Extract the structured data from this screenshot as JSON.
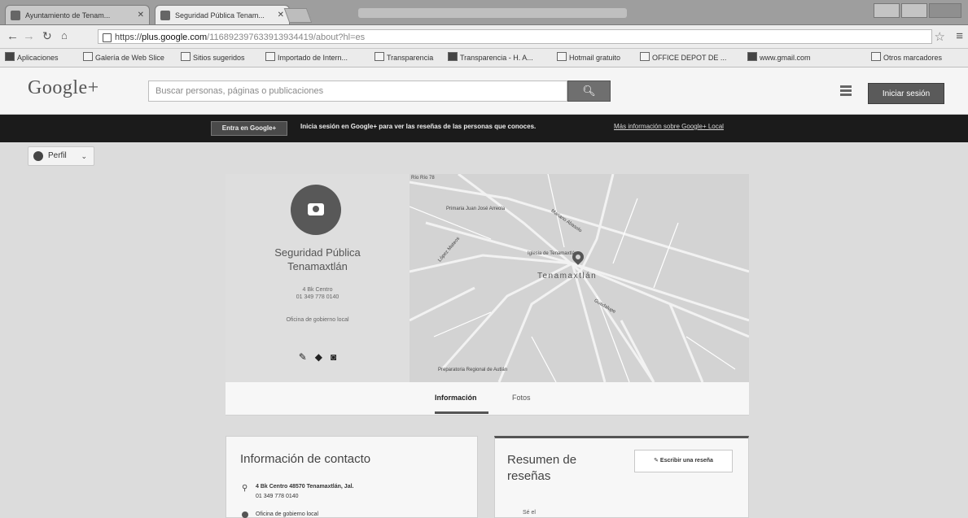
{
  "browser": {
    "tabs": [
      {
        "label": "Ayuntamiento de Tenam..."
      },
      {
        "label": "Seguridad Pública Tenam..."
      }
    ],
    "url_scheme": "https://",
    "url_host": "plus.google.com",
    "url_path": "/116892397633913934419/about?hl=es",
    "bookmarks": [
      {
        "label": "Aplicaciones"
      },
      {
        "label": "Galería de Web Slice"
      },
      {
        "label": "Sitios sugeridos"
      },
      {
        "label": "Importado de Intern..."
      },
      {
        "label": "Transparencia"
      },
      {
        "label": "Transparencia - H. A..."
      },
      {
        "label": "Hotmail gratuito"
      },
      {
        "label": "OFFICE DEPOT DE ..."
      },
      {
        "label": "www.gmail.com"
      },
      {
        "label": "Otros marcadores"
      }
    ]
  },
  "header": {
    "logo": "Google+",
    "search_placeholder": "Buscar personas, páginas o publicaciones",
    "signin_label": "Iniciar sesión"
  },
  "banner": {
    "button_label": "Entra en Google+",
    "text": "Inicia sesión en Google+ para ver las reseñas de las personas que conoces.",
    "link": "Más información sobre Google+ Local"
  },
  "profile": {
    "dropdown_label": "Perfil"
  },
  "business": {
    "name_line1": "Seguridad Pública",
    "name_line2": "Tenamaxtlán",
    "address_line1": "4 Bk Centro",
    "address_line2": "01 349 778 0140",
    "category": "Oficina de gobierno local"
  },
  "map": {
    "city": "Tenamaxtlán",
    "labels": [
      {
        "text": "Río Río 78"
      },
      {
        "text": "Primaria Juan José Arreola"
      },
      {
        "text": "Mariano Abasolo"
      },
      {
        "text": "López Mateos"
      },
      {
        "text": "Iglesia de Tenamaxtlán"
      },
      {
        "text": "Preparatoria Regional de Autlán"
      },
      {
        "text": "Guadalupe"
      }
    ]
  },
  "page_tabs": [
    {
      "label": "Información"
    },
    {
      "label": "Fotos"
    }
  ],
  "contact": {
    "title": "Información de contacto",
    "address_line1": "4 Bk Centro 48570 Tenamaxtlán, Jal.",
    "address_line2": "01 349 778 0140",
    "next_line": "Oficina de gobierno local"
  },
  "reviews": {
    "title_line1": "Resumen de",
    "title_line2": "reseñas",
    "write_label": "Escribir una reseña",
    "note": "Sé el"
  }
}
